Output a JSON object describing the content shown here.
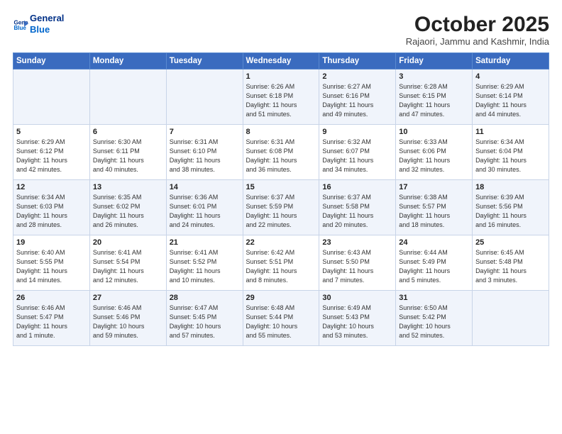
{
  "header": {
    "logo_line1": "General",
    "logo_line2": "Blue",
    "month": "October 2025",
    "location": "Rajaori, Jammu and Kashmir, India"
  },
  "weekdays": [
    "Sunday",
    "Monday",
    "Tuesday",
    "Wednesday",
    "Thursday",
    "Friday",
    "Saturday"
  ],
  "weeks": [
    [
      {
        "day": "",
        "info": ""
      },
      {
        "day": "",
        "info": ""
      },
      {
        "day": "",
        "info": ""
      },
      {
        "day": "1",
        "info": "Sunrise: 6:26 AM\nSunset: 6:18 PM\nDaylight: 11 hours\nand 51 minutes."
      },
      {
        "day": "2",
        "info": "Sunrise: 6:27 AM\nSunset: 6:16 PM\nDaylight: 11 hours\nand 49 minutes."
      },
      {
        "day": "3",
        "info": "Sunrise: 6:28 AM\nSunset: 6:15 PM\nDaylight: 11 hours\nand 47 minutes."
      },
      {
        "day": "4",
        "info": "Sunrise: 6:29 AM\nSunset: 6:14 PM\nDaylight: 11 hours\nand 44 minutes."
      }
    ],
    [
      {
        "day": "5",
        "info": "Sunrise: 6:29 AM\nSunset: 6:12 PM\nDaylight: 11 hours\nand 42 minutes."
      },
      {
        "day": "6",
        "info": "Sunrise: 6:30 AM\nSunset: 6:11 PM\nDaylight: 11 hours\nand 40 minutes."
      },
      {
        "day": "7",
        "info": "Sunrise: 6:31 AM\nSunset: 6:10 PM\nDaylight: 11 hours\nand 38 minutes."
      },
      {
        "day": "8",
        "info": "Sunrise: 6:31 AM\nSunset: 6:08 PM\nDaylight: 11 hours\nand 36 minutes."
      },
      {
        "day": "9",
        "info": "Sunrise: 6:32 AM\nSunset: 6:07 PM\nDaylight: 11 hours\nand 34 minutes."
      },
      {
        "day": "10",
        "info": "Sunrise: 6:33 AM\nSunset: 6:06 PM\nDaylight: 11 hours\nand 32 minutes."
      },
      {
        "day": "11",
        "info": "Sunrise: 6:34 AM\nSunset: 6:04 PM\nDaylight: 11 hours\nand 30 minutes."
      }
    ],
    [
      {
        "day": "12",
        "info": "Sunrise: 6:34 AM\nSunset: 6:03 PM\nDaylight: 11 hours\nand 28 minutes."
      },
      {
        "day": "13",
        "info": "Sunrise: 6:35 AM\nSunset: 6:02 PM\nDaylight: 11 hours\nand 26 minutes."
      },
      {
        "day": "14",
        "info": "Sunrise: 6:36 AM\nSunset: 6:01 PM\nDaylight: 11 hours\nand 24 minutes."
      },
      {
        "day": "15",
        "info": "Sunrise: 6:37 AM\nSunset: 5:59 PM\nDaylight: 11 hours\nand 22 minutes."
      },
      {
        "day": "16",
        "info": "Sunrise: 6:37 AM\nSunset: 5:58 PM\nDaylight: 11 hours\nand 20 minutes."
      },
      {
        "day": "17",
        "info": "Sunrise: 6:38 AM\nSunset: 5:57 PM\nDaylight: 11 hours\nand 18 minutes."
      },
      {
        "day": "18",
        "info": "Sunrise: 6:39 AM\nSunset: 5:56 PM\nDaylight: 11 hours\nand 16 minutes."
      }
    ],
    [
      {
        "day": "19",
        "info": "Sunrise: 6:40 AM\nSunset: 5:55 PM\nDaylight: 11 hours\nand 14 minutes."
      },
      {
        "day": "20",
        "info": "Sunrise: 6:41 AM\nSunset: 5:54 PM\nDaylight: 11 hours\nand 12 minutes."
      },
      {
        "day": "21",
        "info": "Sunrise: 6:41 AM\nSunset: 5:52 PM\nDaylight: 11 hours\nand 10 minutes."
      },
      {
        "day": "22",
        "info": "Sunrise: 6:42 AM\nSunset: 5:51 PM\nDaylight: 11 hours\nand 8 minutes."
      },
      {
        "day": "23",
        "info": "Sunrise: 6:43 AM\nSunset: 5:50 PM\nDaylight: 11 hours\nand 7 minutes."
      },
      {
        "day": "24",
        "info": "Sunrise: 6:44 AM\nSunset: 5:49 PM\nDaylight: 11 hours\nand 5 minutes."
      },
      {
        "day": "25",
        "info": "Sunrise: 6:45 AM\nSunset: 5:48 PM\nDaylight: 11 hours\nand 3 minutes."
      }
    ],
    [
      {
        "day": "26",
        "info": "Sunrise: 6:46 AM\nSunset: 5:47 PM\nDaylight: 11 hours\nand 1 minute."
      },
      {
        "day": "27",
        "info": "Sunrise: 6:46 AM\nSunset: 5:46 PM\nDaylight: 10 hours\nand 59 minutes."
      },
      {
        "day": "28",
        "info": "Sunrise: 6:47 AM\nSunset: 5:45 PM\nDaylight: 10 hours\nand 57 minutes."
      },
      {
        "day": "29",
        "info": "Sunrise: 6:48 AM\nSunset: 5:44 PM\nDaylight: 10 hours\nand 55 minutes."
      },
      {
        "day": "30",
        "info": "Sunrise: 6:49 AM\nSunset: 5:43 PM\nDaylight: 10 hours\nand 53 minutes."
      },
      {
        "day": "31",
        "info": "Sunrise: 6:50 AM\nSunset: 5:42 PM\nDaylight: 10 hours\nand 52 minutes."
      },
      {
        "day": "",
        "info": ""
      }
    ]
  ]
}
